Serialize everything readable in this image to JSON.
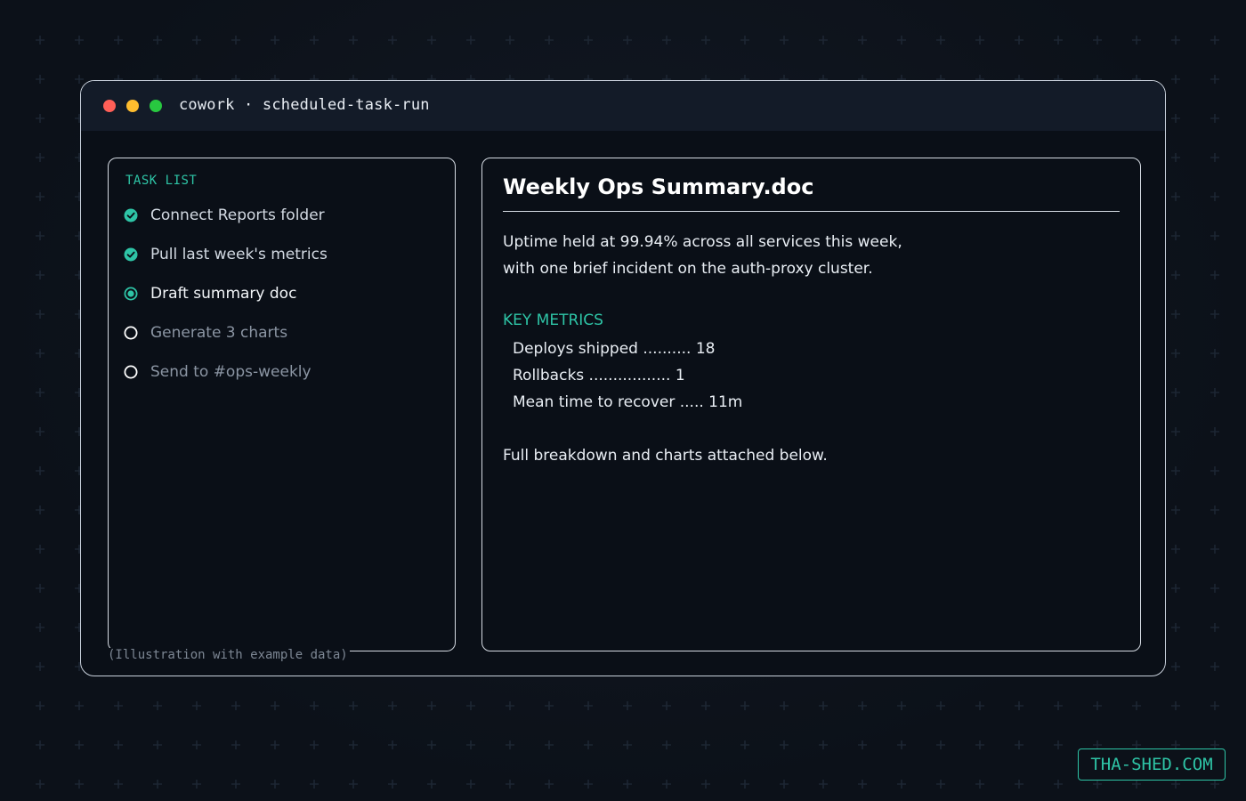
{
  "window": {
    "title": "cowork · scheduled-task-run"
  },
  "task_list": {
    "heading": "TASK LIST",
    "items": [
      {
        "label": "Connect Reports folder",
        "status": "done",
        "icon": "check-circle-icon"
      },
      {
        "label": "Pull last week's metrics",
        "status": "done",
        "icon": "check-circle-icon"
      },
      {
        "label": "Draft summary doc",
        "status": "in-progress",
        "icon": "radio-dot-icon"
      },
      {
        "label": "Generate 3 charts",
        "status": "pending",
        "icon": "empty-circle-icon"
      },
      {
        "label": "Send to #ops-weekly",
        "status": "pending",
        "icon": "empty-circle-icon"
      }
    ]
  },
  "caption": "(Illustration with example data)",
  "document": {
    "title": "Weekly Ops Summary.doc",
    "intro_line1": "Uptime held at 99.94% across all services this week,",
    "intro_line2": "with one brief incident on the auth-proxy cluster.",
    "metrics_heading": "KEY METRICS",
    "metrics": [
      "Deploys shipped .......... 18",
      "Rollbacks ................. 1",
      "Mean time to recover ..... 11m"
    ],
    "footer": "Full breakdown and charts attached below."
  },
  "brand": "THA-SHED.COM",
  "colors": {
    "accent": "#2ec4a6",
    "background": "#0c1119",
    "window_bg": "#0a0f17",
    "titlebar_bg": "#131b28",
    "traffic_red": "#ff5f57",
    "traffic_yellow": "#febc2e",
    "traffic_green": "#28c840"
  }
}
